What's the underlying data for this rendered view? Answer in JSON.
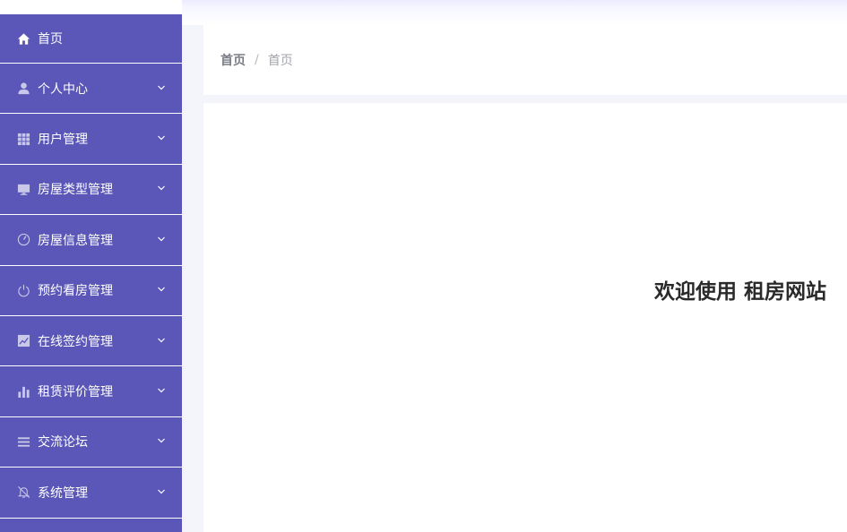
{
  "sidebar": {
    "items": [
      {
        "label": "首页",
        "icon": "home-icon",
        "expandable": false
      },
      {
        "label": "个人中心",
        "icon": "user-icon",
        "expandable": true
      },
      {
        "label": "用户管理",
        "icon": "grid-icon",
        "expandable": true
      },
      {
        "label": "房屋类型管理",
        "icon": "monitor-icon",
        "expandable": true
      },
      {
        "label": "房屋信息管理",
        "icon": "gauge-icon",
        "expandable": true
      },
      {
        "label": "预约看房管理",
        "icon": "power-icon",
        "expandable": true
      },
      {
        "label": "在线签约管理",
        "icon": "chart-line-icon",
        "expandable": true
      },
      {
        "label": "租赁评价管理",
        "icon": "bar-chart-icon",
        "expandable": true
      },
      {
        "label": "交流论坛",
        "icon": "list-icon",
        "expandable": true
      },
      {
        "label": "系统管理",
        "icon": "bell-off-icon",
        "expandable": true
      }
    ]
  },
  "breadcrumb": {
    "home": "首页",
    "separator": "/",
    "current": "首页"
  },
  "main": {
    "welcome": "欢迎使用 租房网站"
  },
  "colors": {
    "sidebar_bg": "#5a57b8",
    "icon_muted": "#c9c8e8"
  }
}
